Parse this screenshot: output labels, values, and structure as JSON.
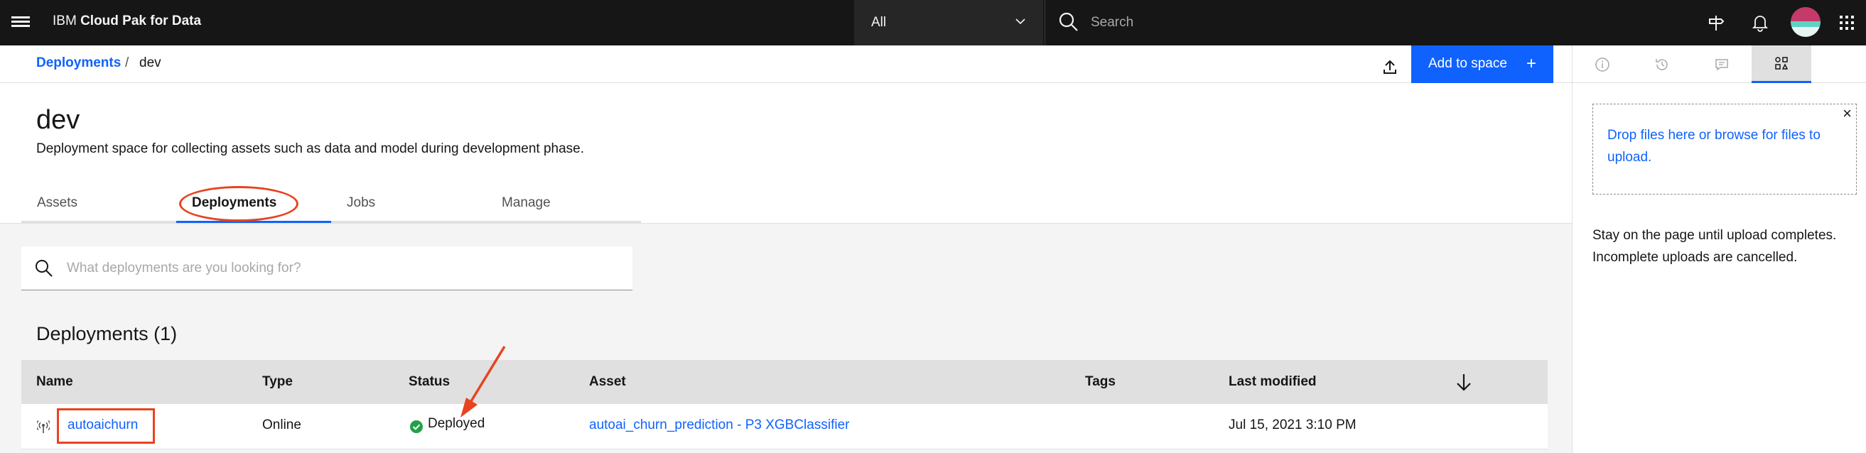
{
  "header": {
    "brand_prefix": "IBM ",
    "brand_name": "Cloud Pak for Data",
    "scope_value": "All",
    "search_placeholder": "Search"
  },
  "breadcrumb": {
    "parent": "Deployments",
    "separator": "/",
    "current": "dev"
  },
  "toolbar": {
    "add_to_space_label": "Add to space",
    "add_icon": "+"
  },
  "space": {
    "title": "dev",
    "description": "Deployment space for collecting assets such as data and model during development phase."
  },
  "tabs": [
    {
      "label": "Assets"
    },
    {
      "label": "Deployments"
    },
    {
      "label": "Jobs"
    },
    {
      "label": "Manage"
    }
  ],
  "deployments": {
    "search_placeholder": "What deployments are you looking for?",
    "count_title": "Deployments (1)",
    "columns": [
      "Name",
      "Type",
      "Status",
      "Asset",
      "Tags",
      "Last modified"
    ],
    "rows": [
      {
        "name": "autoaichurn",
        "type": "Online",
        "status": "Deployed",
        "asset": "autoai_churn_prediction - P3 XGBClassifier",
        "tags": "",
        "last_modified": "Jul 15, 2021 3:10 PM"
      }
    ]
  },
  "right_panel": {
    "tab_icons": [
      "info-icon",
      "history-icon",
      "chat-icon",
      "data-assets-icon"
    ],
    "dropzone_text": "Drop files here or browse for files to upload.",
    "close_glyph": "×",
    "note": "Stay on the page until upload completes. Incomplete uploads are cancelled."
  },
  "colors": {
    "accent": "#0f62fe",
    "annotation": "#e8431f",
    "success": "#24a148",
    "header_bg": "#161616"
  }
}
